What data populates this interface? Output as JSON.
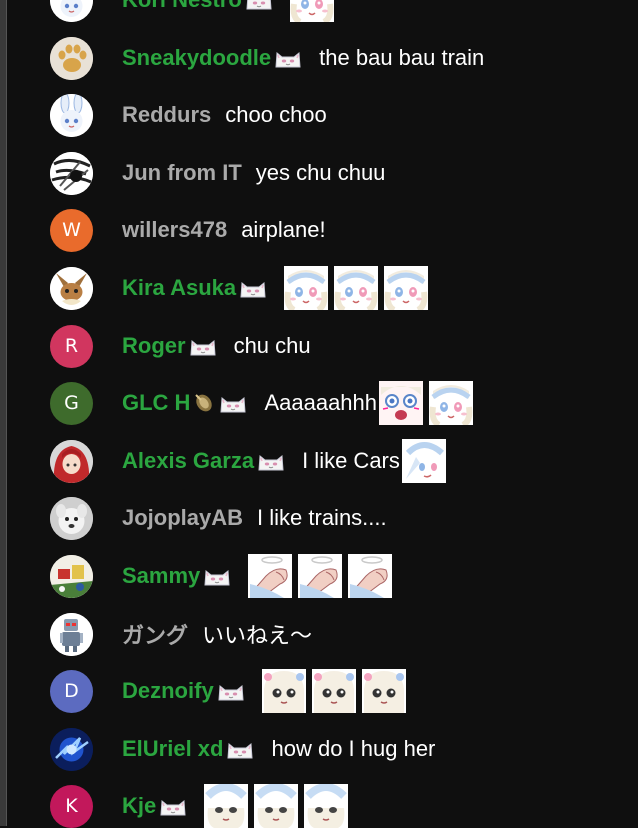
{
  "messages": [
    {
      "author": "Kori Nestro",
      "member": true,
      "avatar": {
        "kind": "image",
        "icon": "bunny-girl-avatar-icon",
        "bg": "#ffffff"
      },
      "badges": [
        "cat-member-badge-icon"
      ],
      "text": "",
      "emotes": [
        "fuwamoco-face-emote-icon"
      ]
    },
    {
      "author": "Sneakydoodle",
      "member": true,
      "avatar": {
        "kind": "image",
        "icon": "paw-print-avatar-icon",
        "bg": "#e8e1d6"
      },
      "badges": [
        "cat-member-badge-icon"
      ],
      "text": "the bau bau train",
      "emotes": []
    },
    {
      "author": "Reddurs",
      "member": false,
      "avatar": {
        "kind": "image",
        "icon": "bunny-girl-avatar-icon",
        "bg": "#ffffff"
      },
      "badges": [],
      "text": "choo choo",
      "emotes": []
    },
    {
      "author": "Jun from IT",
      "member": false,
      "avatar": {
        "kind": "image",
        "icon": "sketch-avatar-icon",
        "bg": "#ffffff"
      },
      "badges": [],
      "text": "yes chu chuu",
      "emotes": []
    },
    {
      "author": "willers478",
      "member": false,
      "avatar": {
        "kind": "letter",
        "letter": "W",
        "bg": "#e96b2c"
      },
      "badges": [],
      "text": "airplane!",
      "emotes": []
    },
    {
      "author": "Kira Asuka",
      "member": true,
      "avatar": {
        "kind": "image",
        "icon": "eevee-avatar-icon",
        "bg": "#ffffff"
      },
      "badges": [
        "cat-member-badge-icon"
      ],
      "text": "",
      "emotes": [
        "fuwamoco-face-emote-icon",
        "fuwamoco-face-emote-icon",
        "fuwamoco-face-emote-icon"
      ]
    },
    {
      "author": "Roger",
      "member": true,
      "avatar": {
        "kind": "letter",
        "letter": "R",
        "bg": "#d1365f"
      },
      "badges": [
        "cat-member-badge-icon"
      ],
      "text": "chu chu",
      "emotes": []
    },
    {
      "author": "GLC H",
      "member": true,
      "avatar": {
        "kind": "letter",
        "letter": "G",
        "bg": "#3e6b2c"
      },
      "badges": [
        "gem-badge-icon",
        "cat-member-badge-icon"
      ],
      "text": "Aaaaaahhh",
      "emotes": [
        "fuwamoco-shout-emote-icon",
        "fuwamoco-face-emote-icon"
      ]
    },
    {
      "author": "Alexis Garza",
      "member": true,
      "avatar": {
        "kind": "image",
        "icon": "red-hair-avatar-icon",
        "bg": "#d8d8d8"
      },
      "badges": [
        "cat-member-badge-icon"
      ],
      "text": "I like Cars",
      "emotes": [
        "fuwamoco-wave-emote-icon"
      ]
    },
    {
      "author": "JojoplayAB",
      "member": false,
      "avatar": {
        "kind": "image",
        "icon": "white-dog-avatar-icon",
        "bg": "#cfcfcf"
      },
      "badges": [],
      "text": "I like trains....",
      "emotes": []
    },
    {
      "author": "Sammy",
      "member": true,
      "avatar": {
        "kind": "image",
        "icon": "colorful-art-avatar-icon",
        "bg": "#f2efe6"
      },
      "badges": [
        "cat-member-badge-icon"
      ],
      "text": "",
      "emotes": [
        "paw-punch-emote-icon",
        "paw-punch-emote-icon",
        "paw-punch-emote-icon"
      ]
    },
    {
      "author": "ガング",
      "member": false,
      "avatar": {
        "kind": "image",
        "icon": "robot-avatar-icon",
        "bg": "#ffffff"
      },
      "badges": [],
      "text": "いいねえ〜",
      "emotes": []
    },
    {
      "author": "Deznoify",
      "member": true,
      "avatar": {
        "kind": "letter",
        "letter": "D",
        "bg": "#5c6bc0"
      },
      "badges": [
        "cat-member-badge-icon"
      ],
      "text": "",
      "emotes": [
        "fuwamoco-peek-emote-icon",
        "fuwamoco-peek-emote-icon",
        "fuwamoco-peek-emote-icon"
      ]
    },
    {
      "author": "ElUriel xd",
      "member": true,
      "avatar": {
        "kind": "image",
        "icon": "blue-energy-avatar-icon",
        "bg": "#0b1e5c"
      },
      "badges": [
        "cat-member-badge-icon"
      ],
      "text": "how do I hug her",
      "emotes": []
    },
    {
      "author": "Kje",
      "member": true,
      "avatar": {
        "kind": "letter",
        "letter": "K",
        "bg": "#c2185b"
      },
      "badges": [
        "cat-member-badge-icon"
      ],
      "text": "",
      "emotes": [
        "fuwamoco-blue-emote-icon",
        "fuwamoco-blue-emote-icon",
        "fuwamoco-blue-emote-icon"
      ]
    }
  ]
}
